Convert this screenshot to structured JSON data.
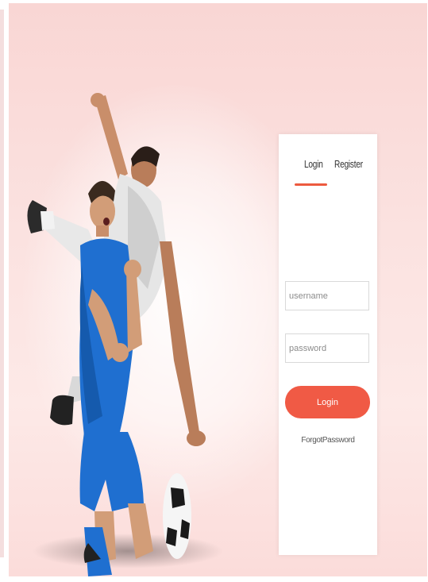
{
  "login_card": {
    "tabs": [
      {
        "label": "Login",
        "active": true
      },
      {
        "label": "Register",
        "active": false
      }
    ],
    "username": {
      "placeholder": "username",
      "value": ""
    },
    "password": {
      "placeholder": "password",
      "value": ""
    },
    "login_button_label": "Login",
    "forgot_password_label": "ForgotPassword"
  },
  "colors": {
    "accent": "#f05a45",
    "tab_underline": "#ec5a3f",
    "background_pink": "#fbe2e0"
  }
}
